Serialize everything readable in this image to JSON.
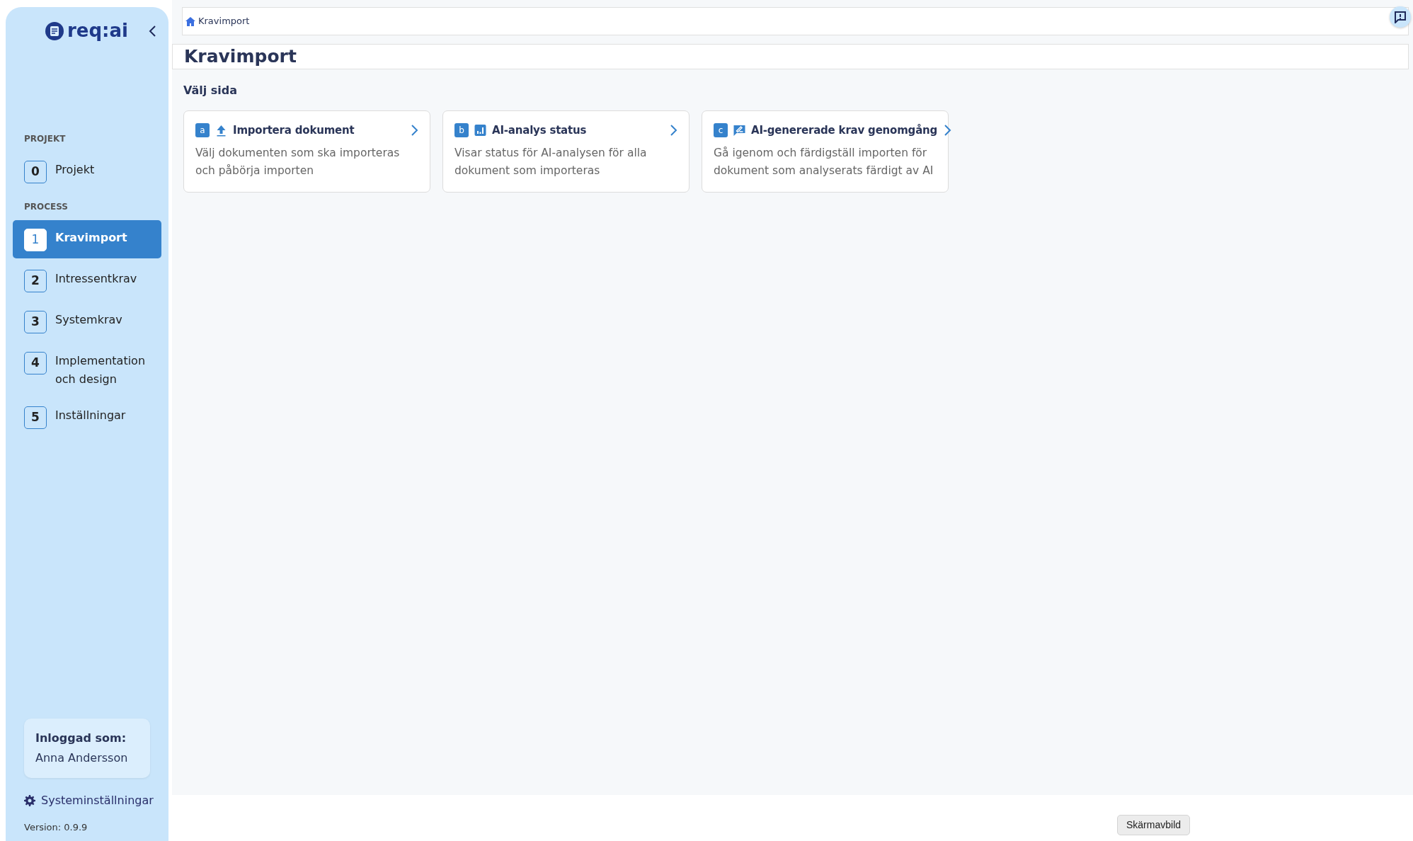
{
  "sidebar": {
    "logo_text": "req:ai",
    "sections": [
      {
        "heading": "PROJEKT",
        "items": [
          {
            "number": "0",
            "label": "Projekt",
            "selected": false
          }
        ]
      },
      {
        "heading": "PROCESS",
        "items": [
          {
            "number": "1",
            "label": "Kravimport",
            "selected": true
          },
          {
            "number": "2",
            "label": "Intressentkrav",
            "selected": false
          },
          {
            "number": "3",
            "label": "Systemkrav",
            "selected": false
          },
          {
            "number": "4",
            "label": "Implementation och design",
            "selected": false
          },
          {
            "number": "5",
            "label": "Inställningar",
            "selected": false
          }
        ]
      }
    ],
    "user": {
      "label": "Inloggad som:",
      "name": "Anna Andersson"
    },
    "settings_link": "Systeminställningar",
    "version": "Version: 0.9.9"
  },
  "breadcrumb": [
    "Kravimport"
  ],
  "page_title": "Kravimport",
  "section_title": "Välj sida",
  "cards": [
    {
      "letter": "a",
      "kind": "upload",
      "title": "Importera dokument",
      "description": "Välj dokumenten som ska importeras och påbörja importen"
    },
    {
      "letter": "b",
      "kind": "chart",
      "title": "AI-analys status",
      "description": "Visar status för AI-analysen för alla dokument som importeras"
    },
    {
      "letter": "c",
      "kind": "review",
      "title": "AI-genererade krav genomgång",
      "description": "Gå igenom och färdigställ importen för dokument som analyserats färdigt av AI"
    }
  ],
  "tooltip": "Skärmavbild"
}
